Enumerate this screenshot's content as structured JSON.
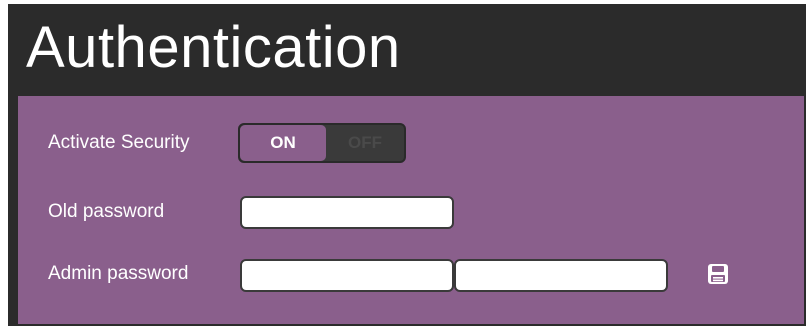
{
  "header": {
    "title": "Authentication"
  },
  "form": {
    "activate_security": {
      "label": "Activate Security",
      "on_label": "ON",
      "off_label": "OFF",
      "value": "ON"
    },
    "old_password": {
      "label": "Old password",
      "value": ""
    },
    "admin_password": {
      "label": "Admin password",
      "value": "",
      "confirm_value": ""
    },
    "save_icon": "save-icon"
  },
  "colors": {
    "header_background": "#2b2b2b",
    "panel_background": "#8a5f8c",
    "toggle_active": "#8a5f8c",
    "toggle_track": "#3a3a3a",
    "text": "#ffffff"
  }
}
